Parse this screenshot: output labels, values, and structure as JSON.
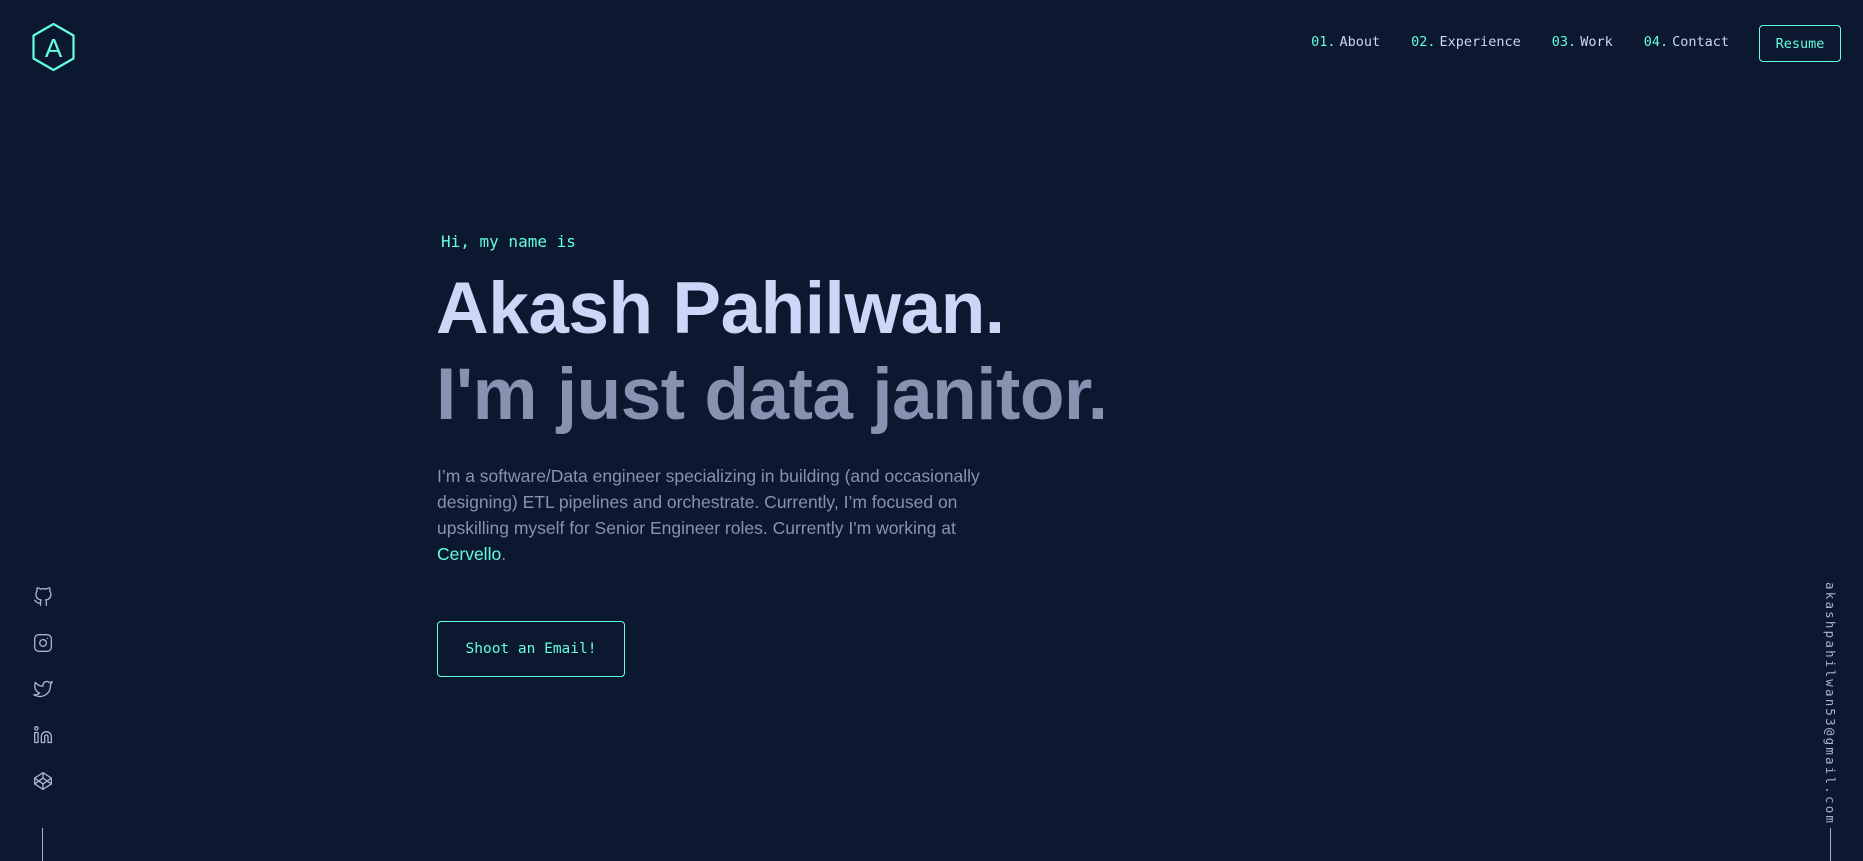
{
  "logo": {
    "letter": "A",
    "icon": "hexagon-logo-icon"
  },
  "nav": {
    "items": [
      {
        "num": "01.",
        "label": "About"
      },
      {
        "num": "02.",
        "label": "Experience"
      },
      {
        "num": "03.",
        "label": "Work"
      },
      {
        "num": "04.",
        "label": "Contact"
      }
    ],
    "resume_label": "Resume"
  },
  "hero": {
    "greeting": "Hi, my name is",
    "name": "Akash Pahilwan.",
    "tagline": "I'm just data janitor.",
    "bio_text": "I’m a software/Data engineer specializing in building (and occasionally designing) ETL pipelines and orchestrate. Currently, I’m focused on upskilling myself for Senior Engineer roles. Currently I'm working at ",
    "bio_link": "Cervello",
    "bio_end": ".",
    "cta_label": "Shoot an Email!"
  },
  "social": {
    "icons": [
      "github-icon",
      "instagram-icon",
      "twitter-icon",
      "linkedin-icon",
      "codepen-icon"
    ]
  },
  "email": "akashpahilwan53@gmail.com",
  "colors": {
    "background": "#0b1830",
    "accent": "#64ffda",
    "heading": "#ccd6f6",
    "body": "#8892b0"
  }
}
